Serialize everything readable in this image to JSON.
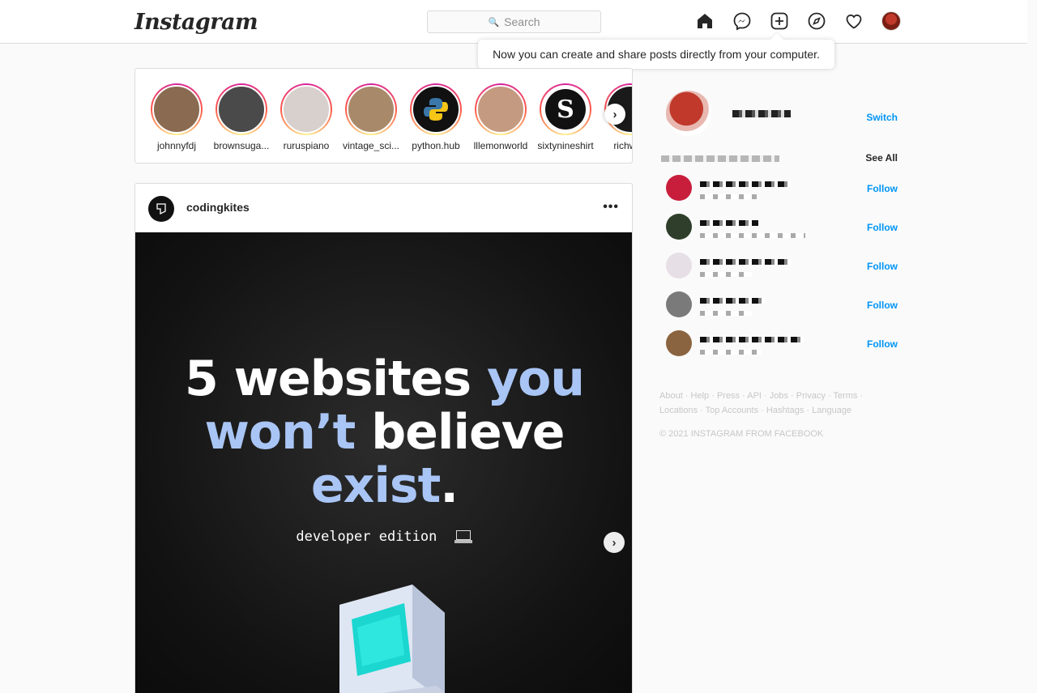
{
  "header": {
    "logo": "Instagram",
    "search_placeholder": "Search"
  },
  "tooltip": {
    "text": "Now you can create and share posts directly from your computer."
  },
  "stories": [
    {
      "name": "johnnyfdj",
      "color": "#8a6a50"
    },
    {
      "name": "brownsuga...",
      "color": "#4a4a4a"
    },
    {
      "name": "ruruspiano",
      "color": "#d8d0cc"
    },
    {
      "name": "vintage_sci...",
      "color": "#a88a6a"
    },
    {
      "name": "python.hub",
      "color": "#111111"
    },
    {
      "name": "lllemonworld",
      "color": "#c49a80"
    },
    {
      "name": "sixtynineshirt",
      "color": "#ffffff"
    },
    {
      "name": "richweb",
      "color": "#1a1a1a"
    }
  ],
  "post": {
    "username": "codingkites",
    "more": "•••",
    "headline_line1_white": "5 websites ",
    "headline_line1_blue": "you",
    "headline_line2_blue": "won’t ",
    "headline_line2_white": "believe",
    "headline_line3_blue": "exist",
    "headline_line3_white": ".",
    "subtitle": "developer edition"
  },
  "sidebar": {
    "switch_label": "Switch",
    "see_all": "See All",
    "suggestions": [
      {
        "follow": "Follow",
        "color": "#c81e3c"
      },
      {
        "follow": "Follow",
        "color": "#2f3e2a"
      },
      {
        "follow": "Follow",
        "color": "#e6e0e6"
      },
      {
        "follow": "Follow",
        "color": "#7a7a7a"
      },
      {
        "follow": "Follow",
        "color": "#8a6440"
      }
    ],
    "footer_links": [
      "About",
      "Help",
      "Press",
      "API",
      "Jobs",
      "Privacy",
      "Terms",
      "Locations",
      "Top Accounts",
      "Hashtags",
      "Language"
    ],
    "copyright": "© 2021 INSTAGRAM FROM FACEBOOK"
  },
  "colors": {
    "accent": "#0095f6",
    "headline_blue": "#a9c5f5",
    "border": "#dbdbdb"
  }
}
